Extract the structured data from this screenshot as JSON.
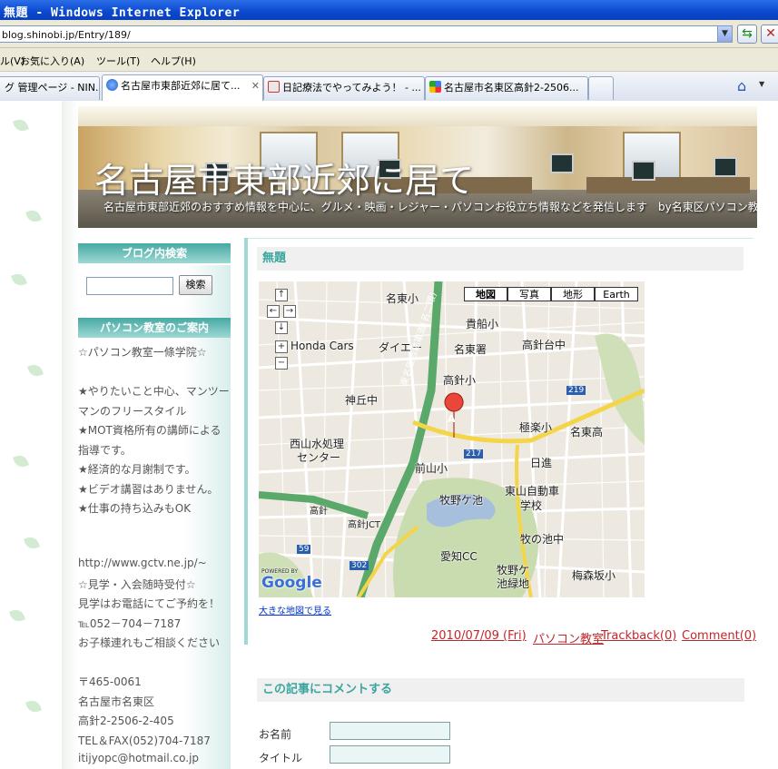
{
  "window": {
    "title": "無題 - Windows Internet Explorer"
  },
  "address": {
    "url": "blog.shinobi.jp/Entry/189/"
  },
  "menu": {
    "items": [
      "ル(V)",
      "お気に入り(A)",
      "ツール(T)",
      "ヘルプ(H)"
    ]
  },
  "tabs": [
    {
      "label": "グ 管理ページ - NIN..."
    },
    {
      "label": "名古屋市東部近郊に居て..."
    },
    {
      "label": "日記療法でやってみよう！ - ..."
    },
    {
      "label": "名古屋市名東区高針2-2506..."
    }
  ],
  "colors": {
    "accent": "#3aa59f",
    "link": "#c0282b",
    "titlebar": "#0a48cf"
  },
  "header": {
    "title": "名古屋市東部近郊に居て",
    "description": "名古屋市東部近郊のおすすめ情報を中心に、グルメ・映画・レジャー・パソコンお役立ち情報などを発信します　by名東区パソコン教室一條学院"
  },
  "sidebar": {
    "search_heading": "ブログ内検索",
    "search_button": "検索",
    "info_heading": "パソコン教室のご案内",
    "lines": [
      "☆パソコン教室一條学院☆",
      "",
      "★やりたいこと中心、マンツー",
      "マンのフリースタイル",
      "★MOT資格所有の講師による",
      "指導です。",
      "★経済的な月謝制です。",
      "★ビデオ講習はありません。",
      "★仕事の持ち込みもOK",
      "",
      "",
      "http://www.gctv.ne.jp/~",
      "☆見学・入会随時受付☆",
      "見学はお電話にてご予約を！",
      "℡052－704－7187",
      "お子様連れもご相談ください",
      "",
      "〒465-0061",
      "名古屋市名東区",
      "高針2-2506-2-405",
      "TEL＆FAX(052)704-7187",
      "itijyopc@hotmail.co.jp"
    ]
  },
  "post": {
    "title": "無題",
    "map": {
      "types": [
        "地図",
        "写真",
        "地形",
        "Earth"
      ],
      "marker": "A",
      "labels": [
        "名東小",
        "貴船小",
        "Honda Cars",
        "ダイエー",
        "名東署",
        "高針台中",
        "高針小",
        "神丘中",
        "極楽小",
        "名東高",
        "西山水処理",
        "センター",
        "前山小",
        "日進",
        "牧野ケ池",
        "東山自動車",
        "学校",
        "高針",
        "高針JCT",
        "牧の池中",
        "愛知CC",
        "牧野ケ",
        "池緑地",
        "梅森坂小",
        "東名阪自動車道(名二環)",
        "219",
        "217",
        "302",
        "59",
        "POWERED BY",
        "Google"
      ]
    },
    "bigmap_link": "大きな地図で見る",
    "date": "2010/07/09 (Fri)",
    "category": "パソコン教室",
    "trackback": "Trackback(0)",
    "comment": "Comment(0)"
  },
  "comment_form": {
    "heading": "この記事にコメントする",
    "name_label": "お名前",
    "title_label": "タイトル"
  }
}
